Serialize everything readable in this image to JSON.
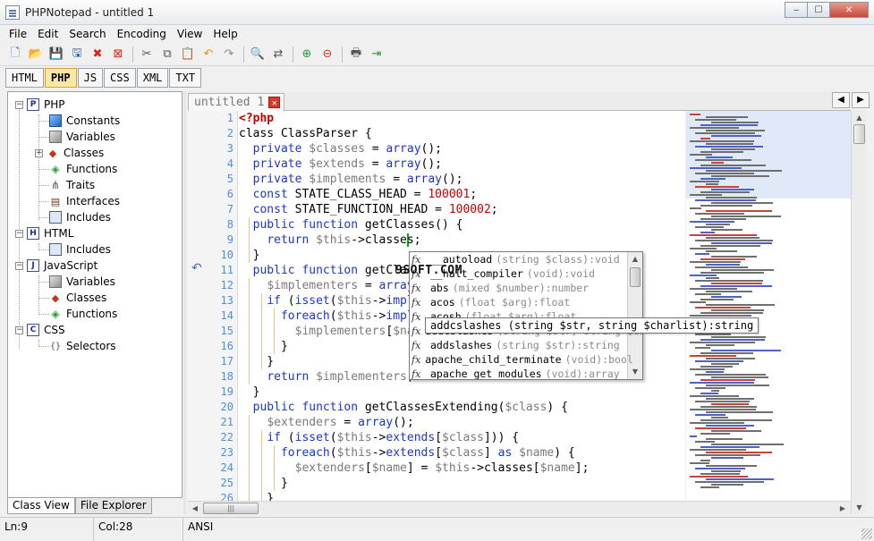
{
  "window": {
    "title": "PHPNotepad - untitled 1",
    "controls": {
      "minimize": "‒",
      "maximize": "☐",
      "close": "✕"
    }
  },
  "menu": [
    "File",
    "Edit",
    "Search",
    "Encoding",
    "View",
    "Help"
  ],
  "toolbar": {
    "buttons": [
      {
        "name": "new-file",
        "glyph": "🗋"
      },
      {
        "name": "open-file",
        "glyph": "📂"
      },
      {
        "name": "save",
        "glyph": "💾"
      },
      {
        "name": "save-all",
        "glyph": "🖫"
      },
      {
        "name": "close-file",
        "glyph": "✖"
      },
      {
        "name": "close-all",
        "glyph": "⊠"
      },
      {
        "name": "cut",
        "glyph": "✂"
      },
      {
        "name": "copy",
        "glyph": "⧉"
      },
      {
        "name": "paste",
        "glyph": "📋"
      },
      {
        "name": "undo",
        "glyph": "↶"
      },
      {
        "name": "redo",
        "glyph": "↷"
      },
      {
        "name": "find",
        "glyph": "🔍"
      },
      {
        "name": "replace",
        "glyph": "⇄"
      },
      {
        "name": "zoom-in",
        "glyph": "⊕"
      },
      {
        "name": "zoom-out",
        "glyph": "⊖"
      },
      {
        "name": "print",
        "glyph": "🖶"
      },
      {
        "name": "exit",
        "glyph": "⇥"
      }
    ]
  },
  "language_tabs": [
    {
      "label": "HTML",
      "active": false
    },
    {
      "label": "PHP",
      "active": true
    },
    {
      "label": "JS",
      "active": false
    },
    {
      "label": "CSS",
      "active": false
    },
    {
      "label": "XML",
      "active": false
    },
    {
      "label": "TXT",
      "active": false
    }
  ],
  "tree": {
    "php": {
      "label": "PHP",
      "items": [
        "Constants",
        "Variables",
        "Classes",
        "Functions",
        "Traits",
        "Interfaces",
        "Includes"
      ]
    },
    "html": {
      "label": "HTML",
      "items": [
        "Includes"
      ]
    },
    "javascript": {
      "label": "JavaScript",
      "items": [
        "Variables",
        "Classes",
        "Functions"
      ]
    },
    "css": {
      "label": "CSS",
      "items": [
        "Selectors"
      ]
    }
  },
  "panel_tabs": [
    {
      "label": "Class View",
      "active": true
    },
    {
      "label": "File Explorer",
      "active": false
    }
  ],
  "editor_tab": {
    "label": "untitled 1",
    "close": "✕"
  },
  "nav_arrows": {
    "prev": "◀",
    "next": "▶"
  },
  "line_numbers": [
    "1",
    "2",
    "3",
    "4",
    "5",
    "6",
    "7",
    "8",
    "9",
    "10",
    "11",
    "12",
    "13",
    "14",
    "15",
    "16",
    "17",
    "18",
    "19",
    "20",
    "21",
    "22",
    "23",
    "24",
    "25",
    "26"
  ],
  "code_lines": [
    [
      {
        "t": "<?php",
        "c": "phptag"
      }
    ],
    [
      {
        "t": "class ClassParser {",
        "c": ""
      }
    ],
    [
      {
        "t": "  ",
        "c": ""
      },
      {
        "t": "private",
        "c": "kw"
      },
      {
        "t": " ",
        "c": ""
      },
      {
        "t": "$classes",
        "c": "var"
      },
      {
        "t": " = ",
        "c": ""
      },
      {
        "t": "array",
        "c": "kw"
      },
      {
        "t": "();",
        "c": ""
      }
    ],
    [
      {
        "t": "  ",
        "c": ""
      },
      {
        "t": "private",
        "c": "kw"
      },
      {
        "t": " ",
        "c": ""
      },
      {
        "t": "$extends",
        "c": "var"
      },
      {
        "t": " = ",
        "c": ""
      },
      {
        "t": "array",
        "c": "kw"
      },
      {
        "t": "();",
        "c": ""
      }
    ],
    [
      {
        "t": "  ",
        "c": ""
      },
      {
        "t": "private",
        "c": "kw"
      },
      {
        "t": " ",
        "c": ""
      },
      {
        "t": "$implements",
        "c": "var"
      },
      {
        "t": " = ",
        "c": ""
      },
      {
        "t": "array",
        "c": "kw"
      },
      {
        "t": "();",
        "c": ""
      }
    ],
    [
      {
        "t": "  ",
        "c": ""
      },
      {
        "t": "const",
        "c": "kw"
      },
      {
        "t": " STATE_CLASS_HEAD = ",
        "c": ""
      },
      {
        "t": "100001",
        "c": "num"
      },
      {
        "t": ";",
        "c": ""
      }
    ],
    [
      {
        "t": "  ",
        "c": ""
      },
      {
        "t": "const",
        "c": "kw"
      },
      {
        "t": " STATE_FUNCTION_HEAD = ",
        "c": ""
      },
      {
        "t": "100002",
        "c": "num"
      },
      {
        "t": ";",
        "c": ""
      }
    ],
    [
      {
        "t": "  ",
        "c": ""
      },
      {
        "t": "public",
        "c": "kw"
      },
      {
        "t": " ",
        "c": ""
      },
      {
        "t": "function",
        "c": "kw"
      },
      {
        "t": " getClasses() {",
        "c": ""
      }
    ],
    [
      {
        "t": "    ",
        "c": ""
      },
      {
        "t": "return",
        "c": "kw"
      },
      {
        "t": " ",
        "c": ""
      },
      {
        "t": "$this",
        "c": "var"
      },
      {
        "t": "->classes;",
        "c": ""
      }
    ],
    [
      {
        "t": "  }",
        "c": ""
      }
    ],
    [
      {
        "t": "  ",
        "c": ""
      },
      {
        "t": "public",
        "c": "kw"
      },
      {
        "t": " ",
        "c": ""
      },
      {
        "t": "function",
        "c": "kw"
      },
      {
        "t": " getClas",
        "c": ""
      }
    ],
    [
      {
        "t": "    ",
        "c": ""
      },
      {
        "t": "$implementers",
        "c": "var"
      },
      {
        "t": " = ",
        "c": ""
      },
      {
        "t": "array",
        "c": "kw"
      },
      {
        "t": "()",
        "c": ""
      }
    ],
    [
      {
        "t": "    ",
        "c": ""
      },
      {
        "t": "if",
        "c": "kw"
      },
      {
        "t": " (",
        "c": ""
      },
      {
        "t": "isset",
        "c": "kw"
      },
      {
        "t": "(",
        "c": ""
      },
      {
        "t": "$this",
        "c": "var"
      },
      {
        "t": "->",
        "c": ""
      },
      {
        "t": "implem",
        "c": "kw"
      }
    ],
    [
      {
        "t": "      ",
        "c": ""
      },
      {
        "t": "foreach",
        "c": "kw"
      },
      {
        "t": "(",
        "c": ""
      },
      {
        "t": "$this",
        "c": "var"
      },
      {
        "t": "->",
        "c": ""
      },
      {
        "t": "implem",
        "c": "kw"
      }
    ],
    [
      {
        "t": "        ",
        "c": ""
      },
      {
        "t": "$implementers",
        "c": "var"
      },
      {
        "t": "[",
        "c": ""
      },
      {
        "t": "$name",
        "c": "var"
      }
    ],
    [
      {
        "t": "      }",
        "c": ""
      }
    ],
    [
      {
        "t": "    }",
        "c": ""
      }
    ],
    [
      {
        "t": "    ",
        "c": ""
      },
      {
        "t": "return",
        "c": "kw"
      },
      {
        "t": " ",
        "c": ""
      },
      {
        "t": "$implementers",
        "c": "var"
      },
      {
        "t": ";",
        "c": ""
      }
    ],
    [
      {
        "t": "  }",
        "c": ""
      }
    ],
    [
      {
        "t": "  ",
        "c": ""
      },
      {
        "t": "public",
        "c": "kw"
      },
      {
        "t": " ",
        "c": ""
      },
      {
        "t": "function",
        "c": "kw"
      },
      {
        "t": " getClassesExtending(",
        "c": ""
      },
      {
        "t": "$class",
        "c": "var"
      },
      {
        "t": ") {",
        "c": ""
      }
    ],
    [
      {
        "t": "    ",
        "c": ""
      },
      {
        "t": "$extenders",
        "c": "var"
      },
      {
        "t": " = ",
        "c": ""
      },
      {
        "t": "array",
        "c": "kw"
      },
      {
        "t": "();",
        "c": ""
      }
    ],
    [
      {
        "t": "    ",
        "c": ""
      },
      {
        "t": "if",
        "c": "kw"
      },
      {
        "t": " (",
        "c": ""
      },
      {
        "t": "isset",
        "c": "kw"
      },
      {
        "t": "(",
        "c": ""
      },
      {
        "t": "$this",
        "c": "var"
      },
      {
        "t": "->",
        "c": ""
      },
      {
        "t": "extends",
        "c": "kw"
      },
      {
        "t": "[",
        "c": ""
      },
      {
        "t": "$class",
        "c": "var"
      },
      {
        "t": "])) {",
        "c": ""
      }
    ],
    [
      {
        "t": "      ",
        "c": ""
      },
      {
        "t": "foreach",
        "c": "kw"
      },
      {
        "t": "(",
        "c": ""
      },
      {
        "t": "$this",
        "c": "var"
      },
      {
        "t": "->",
        "c": ""
      },
      {
        "t": "extends",
        "c": "kw"
      },
      {
        "t": "[",
        "c": ""
      },
      {
        "t": "$class",
        "c": "var"
      },
      {
        "t": "] ",
        "c": ""
      },
      {
        "t": "as",
        "c": "kw"
      },
      {
        "t": " ",
        "c": ""
      },
      {
        "t": "$name",
        "c": "var"
      },
      {
        "t": ") {",
        "c": ""
      }
    ],
    [
      {
        "t": "        ",
        "c": ""
      },
      {
        "t": "$extenders",
        "c": "var"
      },
      {
        "t": "[",
        "c": ""
      },
      {
        "t": "$name",
        "c": "var"
      },
      {
        "t": "] = ",
        "c": ""
      },
      {
        "t": "$this",
        "c": "var"
      },
      {
        "t": "->classes[",
        "c": ""
      },
      {
        "t": "$name",
        "c": "var"
      },
      {
        "t": "];",
        "c": ""
      }
    ],
    [
      {
        "t": "      }",
        "c": ""
      }
    ],
    [
      {
        "t": "    }",
        "c": ""
      }
    ]
  ],
  "autocomplete": {
    "items": [
      {
        "name": "__autoload",
        "sig": "(string $class):void"
      },
      {
        "name": "__halt_compiler",
        "sig": "(void):void"
      },
      {
        "name": "abs",
        "sig": "(mixed $number):number"
      },
      {
        "name": "acos",
        "sig": "(float $arg):float"
      },
      {
        "name": "acosh",
        "sig": "(float $arg):float"
      },
      {
        "name": "addcslashes",
        "sig": "(string $str, string $charlist):string"
      },
      {
        "name": "addslashes",
        "sig": "(string $str):string"
      },
      {
        "name": "apache_child_terminate",
        "sig": "(void):bool"
      },
      {
        "name": "apache_get_modules",
        "sig": "(void):array"
      }
    ],
    "icon": "fx",
    "tooltip": "addcslashes (string $str, string $charlist):string",
    "scroll_up": "▲",
    "scroll_down": "▼"
  },
  "watermark": "9SOFT.COM",
  "fold_marker": "↶",
  "scrollbars": {
    "up": "▲",
    "down": "▼",
    "left": "◀",
    "right": "▶",
    "grip": "|||"
  },
  "status": {
    "line": "Ln:9",
    "col": "Col:28",
    "encoding": "ANSI"
  }
}
